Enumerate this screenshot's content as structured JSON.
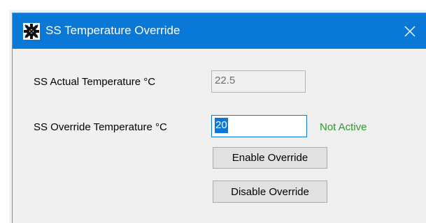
{
  "window": {
    "title": "SS Temperature Override",
    "icon": "gear-icon",
    "close_icon": "close-icon",
    "colors": {
      "titlebar": "#0a78d7",
      "status_inactive": "#2a9a2a",
      "body": "#f0f0f0"
    }
  },
  "form": {
    "actual_label": "SS Actual Temperature °C",
    "actual_value": "22.5",
    "override_label": "SS Override Temperature °C",
    "override_value": "20",
    "status": "Not Active",
    "enable_button": "Enable Override",
    "disable_button": "Disable Override"
  }
}
